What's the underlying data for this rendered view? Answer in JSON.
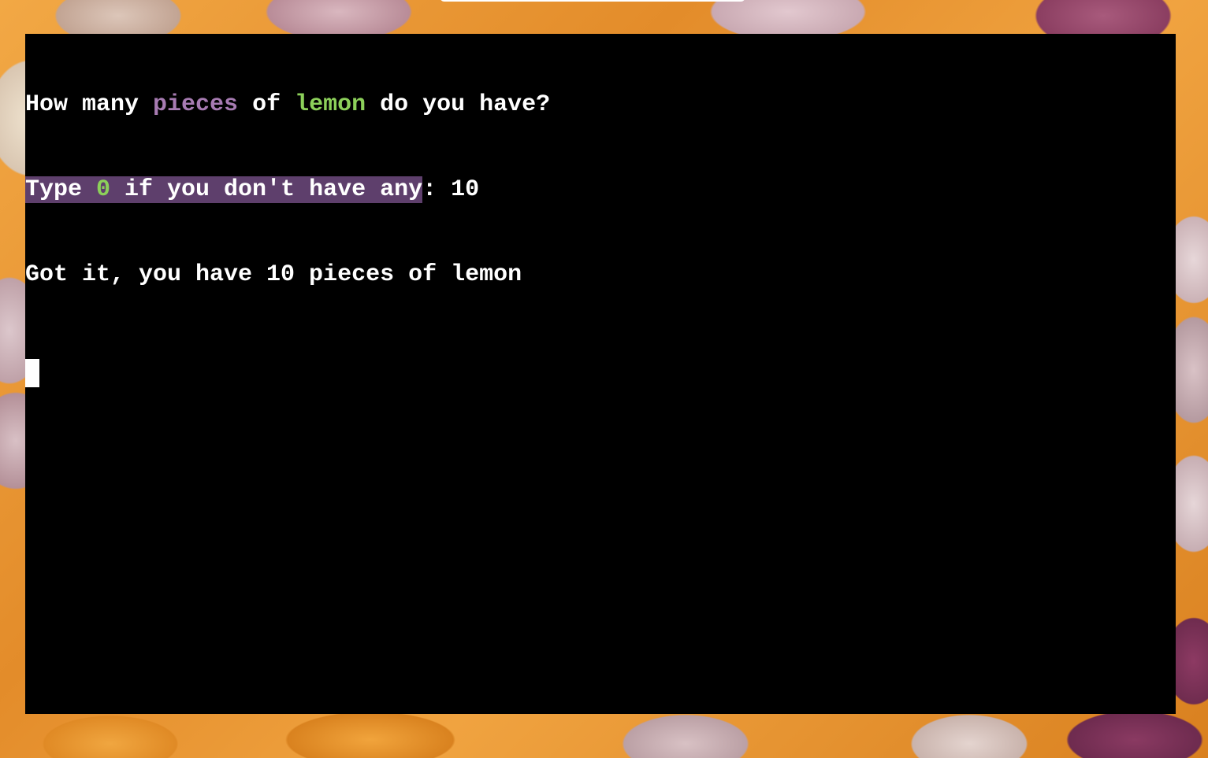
{
  "colors": {
    "terminal_background": "#000000",
    "text": "#ffffff",
    "accent_unit": "#a77bb2",
    "accent_ingredient": "#8cd05a",
    "highlight_background": "#5e3f6c"
  },
  "terminal": {
    "lines": [
      {
        "segments": [
          {
            "text": "How many "
          },
          {
            "text": "pieces"
          },
          {
            "text": " of "
          },
          {
            "text": "lemon"
          },
          {
            "text": " do you have?"
          }
        ]
      },
      {
        "segments": [
          {
            "text": "Type "
          },
          {
            "text": "0"
          },
          {
            "text": " if you don't have any"
          },
          {
            "text": ": "
          },
          {
            "text": "10"
          }
        ]
      },
      {
        "segments": [
          {
            "text": "Got it, you have 10 pieces of lemon"
          }
        ]
      }
    ],
    "cursor": "block-cursor"
  }
}
